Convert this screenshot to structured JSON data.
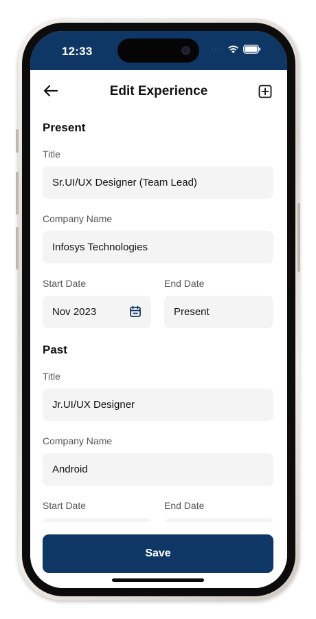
{
  "status_bar": {
    "time": "12:33",
    "signal": "····"
  },
  "header": {
    "title": "Edit Experience",
    "back_icon": "arrow-left-icon",
    "add_icon": "plus-square-icon"
  },
  "present": {
    "section_title": "Present",
    "title_label": "Title",
    "title_value": "Sr.UI/UX Designer (Team Lead)",
    "company_label": "Company Name",
    "company_value": "Infosys Technologies",
    "start_label": "Start Date",
    "start_value": "Nov 2023",
    "end_label": "End Date",
    "end_value": "Present"
  },
  "past": {
    "section_title": "Past",
    "title_label": "Title",
    "title_value": "Jr.UI/UX Designer",
    "company_label": "Company Name",
    "company_value": "Android",
    "start_label": "Start Date",
    "end_label": "End Date"
  },
  "save_label": "Save",
  "colors": {
    "primary": "#0f3765",
    "field_bg": "#f4f4f4",
    "label": "#555555"
  }
}
